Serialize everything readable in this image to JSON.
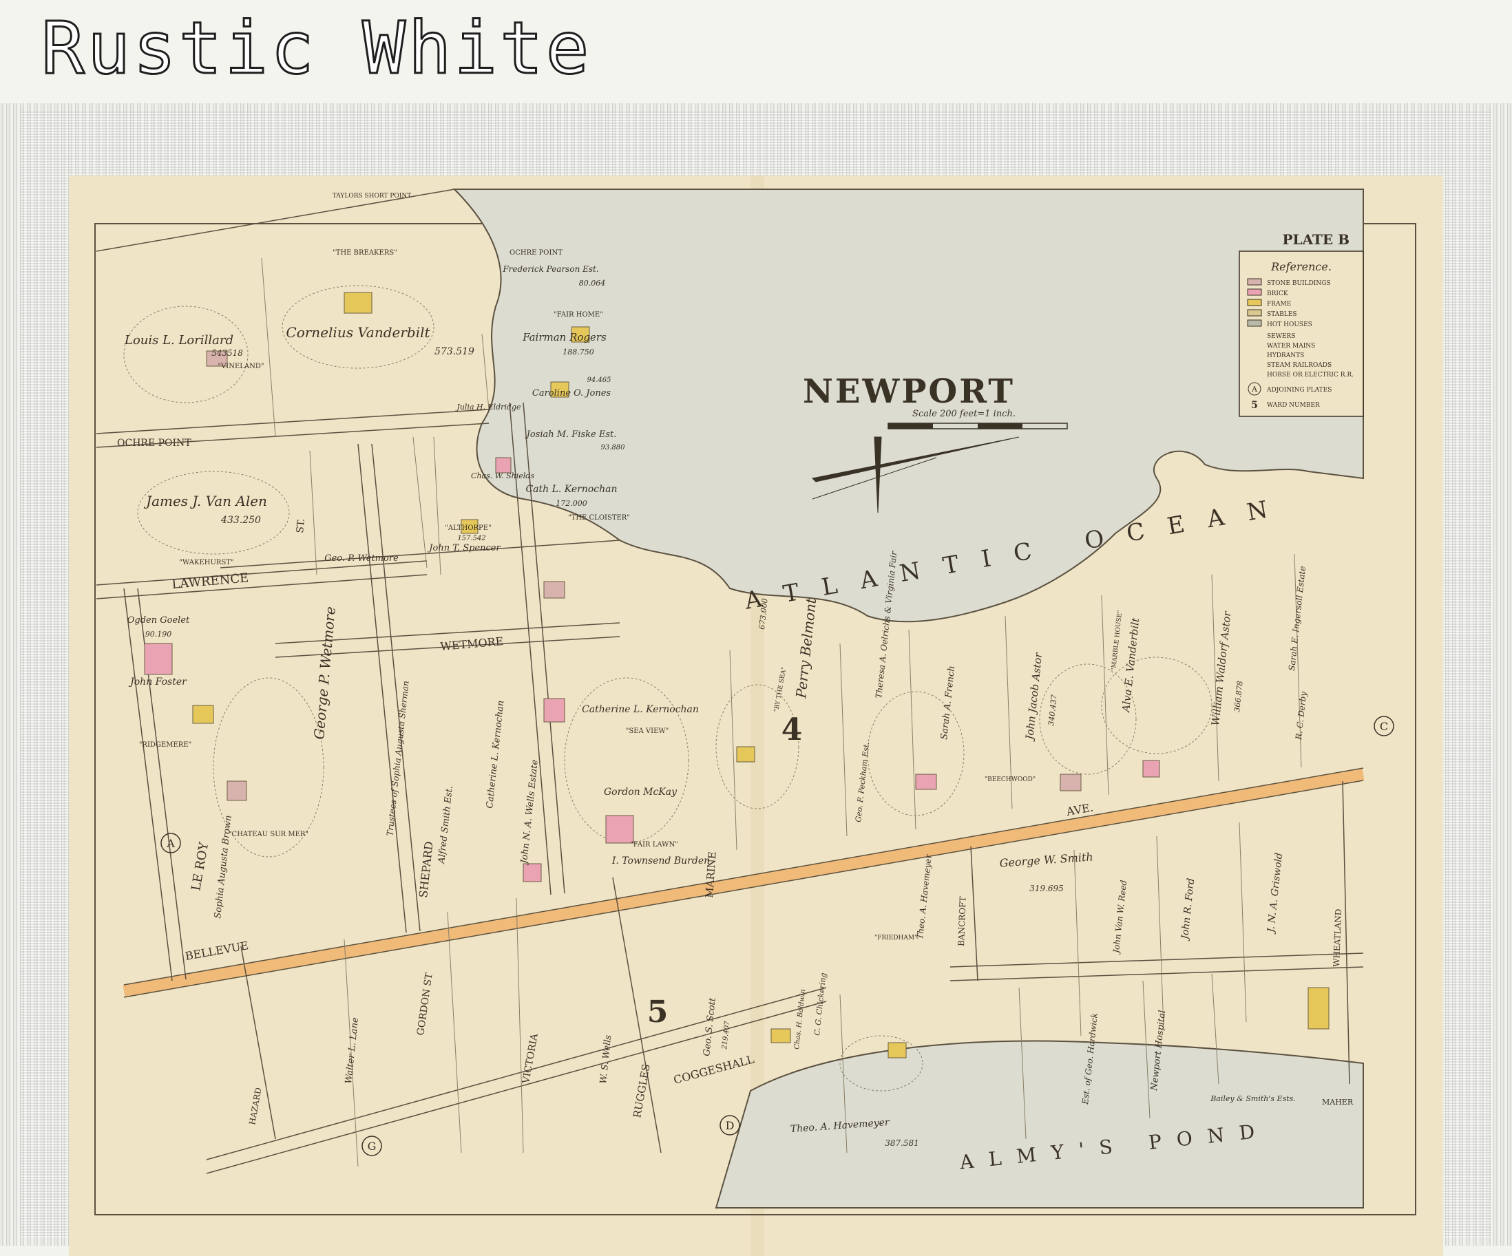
{
  "banner": {
    "title": "Rustic White"
  },
  "map": {
    "plate": "PLATE B",
    "title": "NEWPORT",
    "scale": "Scale 200 feet=1 inch.",
    "reference": {
      "title": "Reference.",
      "items": [
        {
          "label": "STONE BUILDINGS",
          "color": "#d8b3ae"
        },
        {
          "label": "BRICK",
          "color": "#e9a3b2"
        },
        {
          "label": "FRAME",
          "color": "#e6c85a"
        },
        {
          "label": "STABLES",
          "color": "#d9c88f"
        },
        {
          "label": "HOT HOUSES",
          "color": "#b9b9a8"
        }
      ],
      "lines": [
        "SEWERS",
        "WATER MAINS",
        "HYDRANTS",
        "STEAM RAILROADS",
        "HORSE OR ELECTRIC R.R."
      ],
      "plates_label": "ADJOINING PLATES",
      "ward_label": "WARD NUMBER"
    },
    "water": {
      "ocean": "ATLANTIC OCEAN",
      "pond": "ALMY'S POND"
    },
    "points": {
      "taylor": "TAYLORS SHORT POINT",
      "ochre": "OCHRE POINT"
    },
    "wards": [
      "4",
      "5"
    ],
    "plates": [
      "A",
      "C",
      "D",
      "G"
    ],
    "streets": {
      "ochre_point": "OCHRE POINT",
      "lawrence": "LAWRENCE",
      "wetmore": "WETMORE",
      "bellevue": "BELLEVUE",
      "ave": "AVE.",
      "le_roy": "LE ROY",
      "shepard": "SHEPARD",
      "marine": "MARINE",
      "ruggles": "RUGGLES",
      "victoria": "VICTORIA",
      "gordon": "GORDON ST",
      "hazard": "HAZARD",
      "coggeshall": "COGGESHALL",
      "bancroft": "BANCROFT",
      "wheatland": "WHEATLAND",
      "maher": "MAHER",
      "st": "ST."
    },
    "owners": {
      "vanderbilt": "Cornelius Vanderbilt",
      "vanderbilt_area": "573.519",
      "lorillard": "Louis L. Lorillard",
      "lorillard_area": "543518",
      "breakers": "\"THE BREAKERS\"",
      "vineland": "\"VINELAND\"",
      "van_alen": "James J. Van Alen",
      "van_alen_area": "433.250",
      "wakehurst": "\"WAKEHURST\"",
      "pearson": "Frederick Pearson Est.",
      "pearson_area": "80.064",
      "rogers": "Fairman Rogers",
      "rogers_area": "188.750",
      "fair_home": "\"FAIR HOME\"",
      "jones": "Caroline O. Jones",
      "jones_area": "94.465",
      "fiske": "Josiah M. Fiske Est.",
      "fiske_area": "93.880",
      "kernochan_cath": "Cath L. Kernochan",
      "kernochan_cath_area": "172.000",
      "cloister": "\"THE CLOISTER\"",
      "eldridge": "Julia H. Eldridge",
      "shields": "Chas. W. Shields",
      "spencer": "John T. Spencer",
      "althorpe": "\"ALTHORPE\"",
      "spencer_area": "157.542",
      "wetmore_geo": "Geo. P. Wetmore",
      "wetmore_big": "George P. Wetmore",
      "chateau": "\"CHATEAU SUR MER\"",
      "goelet": "Ogden Goelet",
      "goelet_area": "90.190",
      "foster": "John Foster",
      "ridgemere": "\"RIDGEMERE\"",
      "brown": "Sophia Augusta Brown",
      "sherman": "Trustees of Sophia Augusta Sherman",
      "smith_alfred": "Alfred Smith Est.",
      "wells_jnw": "John N. A. Wells Estate",
      "kernochan_cath2": "Catherine L. Kernochan",
      "kernochan_cl": "Catherine L. Kernochan",
      "seaview": "\"SEA VIEW\"",
      "mckay": "Gordon McKay",
      "burden": "I. Townsend Burden",
      "fairlawn": "\"FAIR LAWN\"",
      "belmont": "Perry Belmont",
      "belmont_area": "673.000",
      "bythesea": "\"BY THE SEA\"",
      "oelrichs": "Theresa A. Oelrichs & Virginia Fair",
      "peckham": "Geo. F. Peckham Est.",
      "french": "Sarah A. French",
      "astor_jj": "John Jacob Astor",
      "astor_jj_area": "340.437",
      "beechwood": "\"BEECHWOOD\"",
      "vanderbilt_alva": "Alva E. Vanderbilt",
      "marble": "\"MARBLE HOUSE\"",
      "astor_ww": "William Waldorf Astor",
      "astor_ww_area": "366.878",
      "ingersoll": "Sarah E. Ingersoll Estate",
      "berry": "R. C. Derby",
      "smith_gw": "George W. Smith",
      "smith_gw_area": "319.695",
      "havemeyer": "Theo. A. Havemeyer",
      "havemeyer_area": "387.581",
      "friedham": "\"FRIEDHAM\"",
      "reed": "John Van W. Reed",
      "ford": "John R. Ford",
      "griswold": "J. N. A. Griswold",
      "scott": "Geo. S. Scott",
      "scott_area": "219.407",
      "wells_ws": "W. S. Wells",
      "chickering": "C. G. Chickering",
      "baldwin": "Chas. H. Baldwin",
      "hardwick": "Est. of Geo. Hardwick",
      "hospital": "Newport Hospital",
      "bailey": "Bailey & Smith's Ests.",
      "lane": "Walter L. Lane",
      "havemeyer2": "Theo. A. Havemeyer"
    }
  }
}
